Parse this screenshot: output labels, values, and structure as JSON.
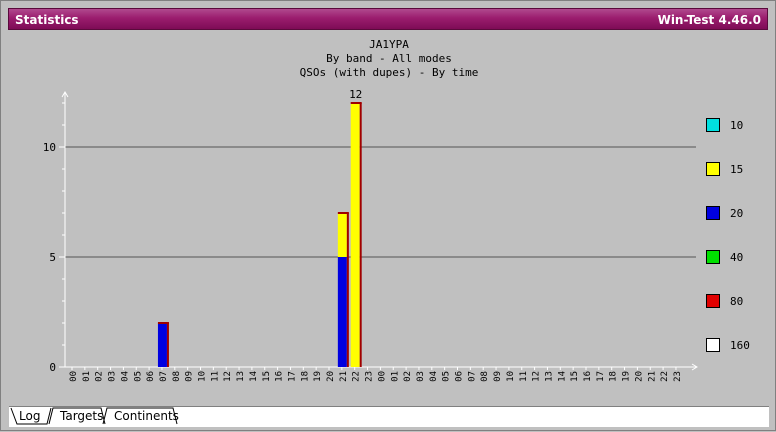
{
  "window": {
    "title": "Statistics",
    "app_version": "Win-Test 4.46.0"
  },
  "chart_data": {
    "type": "bar",
    "title": "JA1YPA",
    "subtitle1": "By band - All modes",
    "subtitle2": "QSOs (with dupes) - By time",
    "categories": [
      "00",
      "01",
      "02",
      "03",
      "04",
      "05",
      "06",
      "07",
      "08",
      "09",
      "10",
      "11",
      "12",
      "13",
      "14",
      "15",
      "16",
      "17",
      "18",
      "19",
      "20",
      "21",
      "22",
      "23",
      "00",
      "01",
      "02",
      "03",
      "04",
      "05",
      "06",
      "07",
      "08",
      "09",
      "10",
      "11",
      "12",
      "13",
      "14",
      "15",
      "16",
      "17",
      "18",
      "19",
      "20",
      "21",
      "22",
      "23"
    ],
    "series": [
      {
        "name": "10",
        "color": "#00e0e0",
        "values": [
          0,
          0,
          0,
          0,
          0,
          0,
          0,
          0,
          0,
          0,
          0,
          0,
          0,
          0,
          0,
          0,
          0,
          0,
          0,
          0,
          0,
          0,
          0,
          0,
          0,
          0,
          0,
          0,
          0,
          0,
          0,
          0,
          0,
          0,
          0,
          0,
          0,
          0,
          0,
          0,
          0,
          0,
          0,
          0,
          0,
          0,
          0,
          0
        ]
      },
      {
        "name": "15",
        "color": "#ffff00",
        "values": [
          0,
          0,
          0,
          0,
          0,
          0,
          0,
          0,
          0,
          0,
          0,
          0,
          0,
          0,
          0,
          0,
          0,
          0,
          0,
          0,
          0,
          2,
          12,
          0,
          0,
          0,
          0,
          0,
          0,
          0,
          0,
          0,
          0,
          0,
          0,
          0,
          0,
          0,
          0,
          0,
          0,
          0,
          0,
          0,
          0,
          0,
          0,
          0
        ]
      },
      {
        "name": "20",
        "color": "#0000e0",
        "values": [
          0,
          0,
          0,
          0,
          0,
          0,
          0,
          2,
          0,
          0,
          0,
          0,
          0,
          0,
          0,
          0,
          0,
          0,
          0,
          0,
          0,
          5,
          0,
          0,
          0,
          0,
          0,
          0,
          0,
          0,
          0,
          0,
          0,
          0,
          0,
          0,
          0,
          0,
          0,
          0,
          0,
          0,
          0,
          0,
          0,
          0,
          0,
          0
        ]
      },
      {
        "name": "40",
        "color": "#00e000",
        "values": [
          0,
          0,
          0,
          0,
          0,
          0,
          0,
          0,
          0,
          0,
          0,
          0,
          0,
          0,
          0,
          0,
          0,
          0,
          0,
          0,
          0,
          0,
          0,
          0,
          0,
          0,
          0,
          0,
          0,
          0,
          0,
          0,
          0,
          0,
          0,
          0,
          0,
          0,
          0,
          0,
          0,
          0,
          0,
          0,
          0,
          0,
          0,
          0
        ]
      },
      {
        "name": "80",
        "color": "#e00000",
        "values": [
          0,
          0,
          0,
          0,
          0,
          0,
          0,
          0,
          0,
          0,
          0,
          0,
          0,
          0,
          0,
          0,
          0,
          0,
          0,
          0,
          0,
          0,
          0,
          0,
          0,
          0,
          0,
          0,
          0,
          0,
          0,
          0,
          0,
          0,
          0,
          0,
          0,
          0,
          0,
          0,
          0,
          0,
          0,
          0,
          0,
          0,
          0,
          0
        ]
      },
      {
        "name": "160",
        "color": "#ffffff",
        "values": [
          0,
          0,
          0,
          0,
          0,
          0,
          0,
          0,
          0,
          0,
          0,
          0,
          0,
          0,
          0,
          0,
          0,
          0,
          0,
          0,
          0,
          0,
          0,
          0,
          0,
          0,
          0,
          0,
          0,
          0,
          0,
          0,
          0,
          0,
          0,
          0,
          0,
          0,
          0,
          0,
          0,
          0,
          0,
          0,
          0,
          0,
          0,
          0
        ]
      }
    ],
    "max_label": "12",
    "ylim": [
      0,
      12
    ],
    "yticks": [
      "0",
      "5",
      "10"
    ],
    "ytick_values": [
      0,
      5,
      10
    ],
    "grid": true,
    "legend_position": "right"
  },
  "tabs": [
    {
      "label": "Log"
    },
    {
      "label": "Targets"
    },
    {
      "label": "Continents"
    }
  ]
}
